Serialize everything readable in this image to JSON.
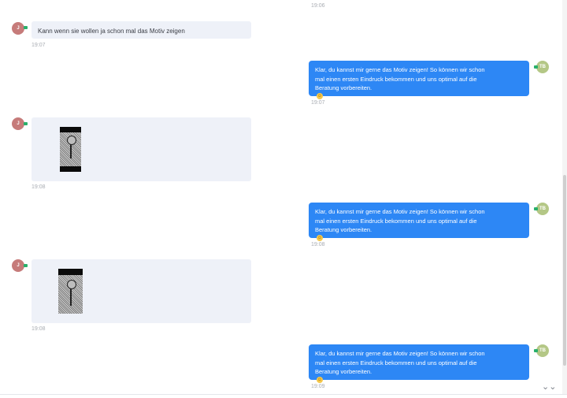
{
  "messages": {
    "top_time": "19:06",
    "m1": {
      "avatar": "J",
      "text": "Kann wenn sie wollen ja schon mal das Motiv zeigen",
      "time": "19:07"
    },
    "m2": {
      "avatar": "TB",
      "line1": "Klar, du kannst mir gerne das Motiv zeigen! So können wir schon",
      "line2": "mal einen ersten Eindruck bekommen und uns optimal auf die",
      "line3": "Beratung vorbereiten.",
      "emoji": "☺",
      "time": "19:07"
    },
    "m3": {
      "avatar": "J",
      "time": "19:08"
    },
    "m4": {
      "avatar": "TB",
      "line1": "Klar, du kannst mir gerne das Motiv zeigen! So können wir schon",
      "line2": "mal einen ersten Eindruck bekommen und uns optimal auf die",
      "line3": "Beratung vorbereiten.",
      "emoji": "☺",
      "time": "19:08"
    },
    "m5": {
      "avatar": "J",
      "time": "19:08"
    },
    "m6": {
      "avatar": "TB",
      "line1": "Klar, du kannst mir gerne das Motiv zeigen! So können wir schon",
      "line2": "mal einen ersten Eindruck bekommen und uns optimal auf die",
      "line3": "Beratung vorbereiten.",
      "emoji": "☺",
      "time": "19:09"
    }
  },
  "icons": {
    "scroll_down": "double-chevron-down-icon",
    "scroll_down_glyph": "⌄⌄"
  },
  "colors": {
    "outgoing_bubble": "#2d87f5",
    "incoming_bubble": "#eef1f8",
    "avatar_customer": "#c67b7a",
    "avatar_agent": "#b4c786",
    "online_badge": "#29b06b"
  }
}
